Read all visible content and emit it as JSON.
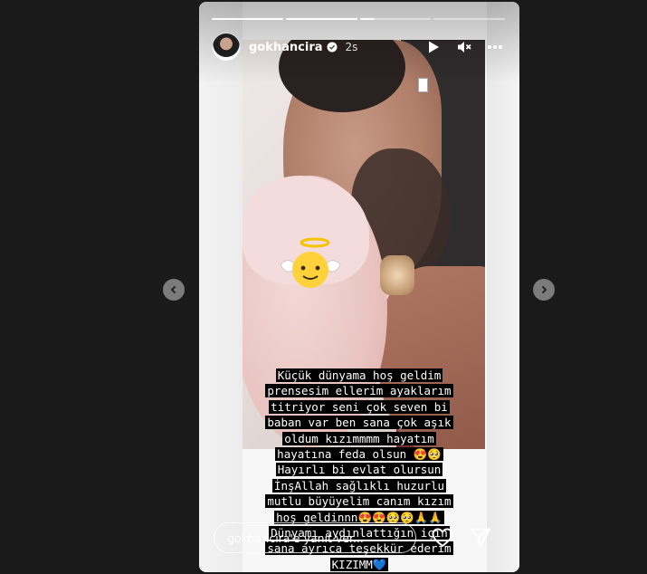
{
  "story": {
    "username": "gokhancira",
    "time_ago": "2s",
    "progress": [
      1,
      1,
      0.2,
      0
    ],
    "caption_lines": [
      "Küçük dünyama hoş geldim",
      "prensesim ellerim ayaklarım",
      "titriyor seni çok seven bi",
      "baban var ben sana çok aşık",
      "oldum kızımmmm hayatım",
      "hayatına feda olsun 😍🥺",
      "Hayırlı bi evlat olursun",
      "İnşAllah sağlıklı huzurlu",
      "mutlu büyüyelim canım kızım",
      "hoş geldinnn😍😍🥺🥺🙏🙏",
      "Dünyamı aydınlattığın için",
      "sana ayrıca teşekkür ederim",
      "KIZIMM💙"
    ],
    "reply_placeholder": "gokhancira'e yanıt ver..."
  },
  "icons": {
    "play": "play-icon",
    "mute": "muted-speaker-icon",
    "more": "more-horizontal-icon",
    "heart": "heart-icon",
    "send": "send-icon",
    "prev": "chevron-left-icon",
    "next": "chevron-right-icon",
    "verified": "verified-badge-icon"
  },
  "colors": {
    "page_background": "#1a1a1a",
    "caption_background": "#000000",
    "verified_blue": "#3897f0"
  }
}
